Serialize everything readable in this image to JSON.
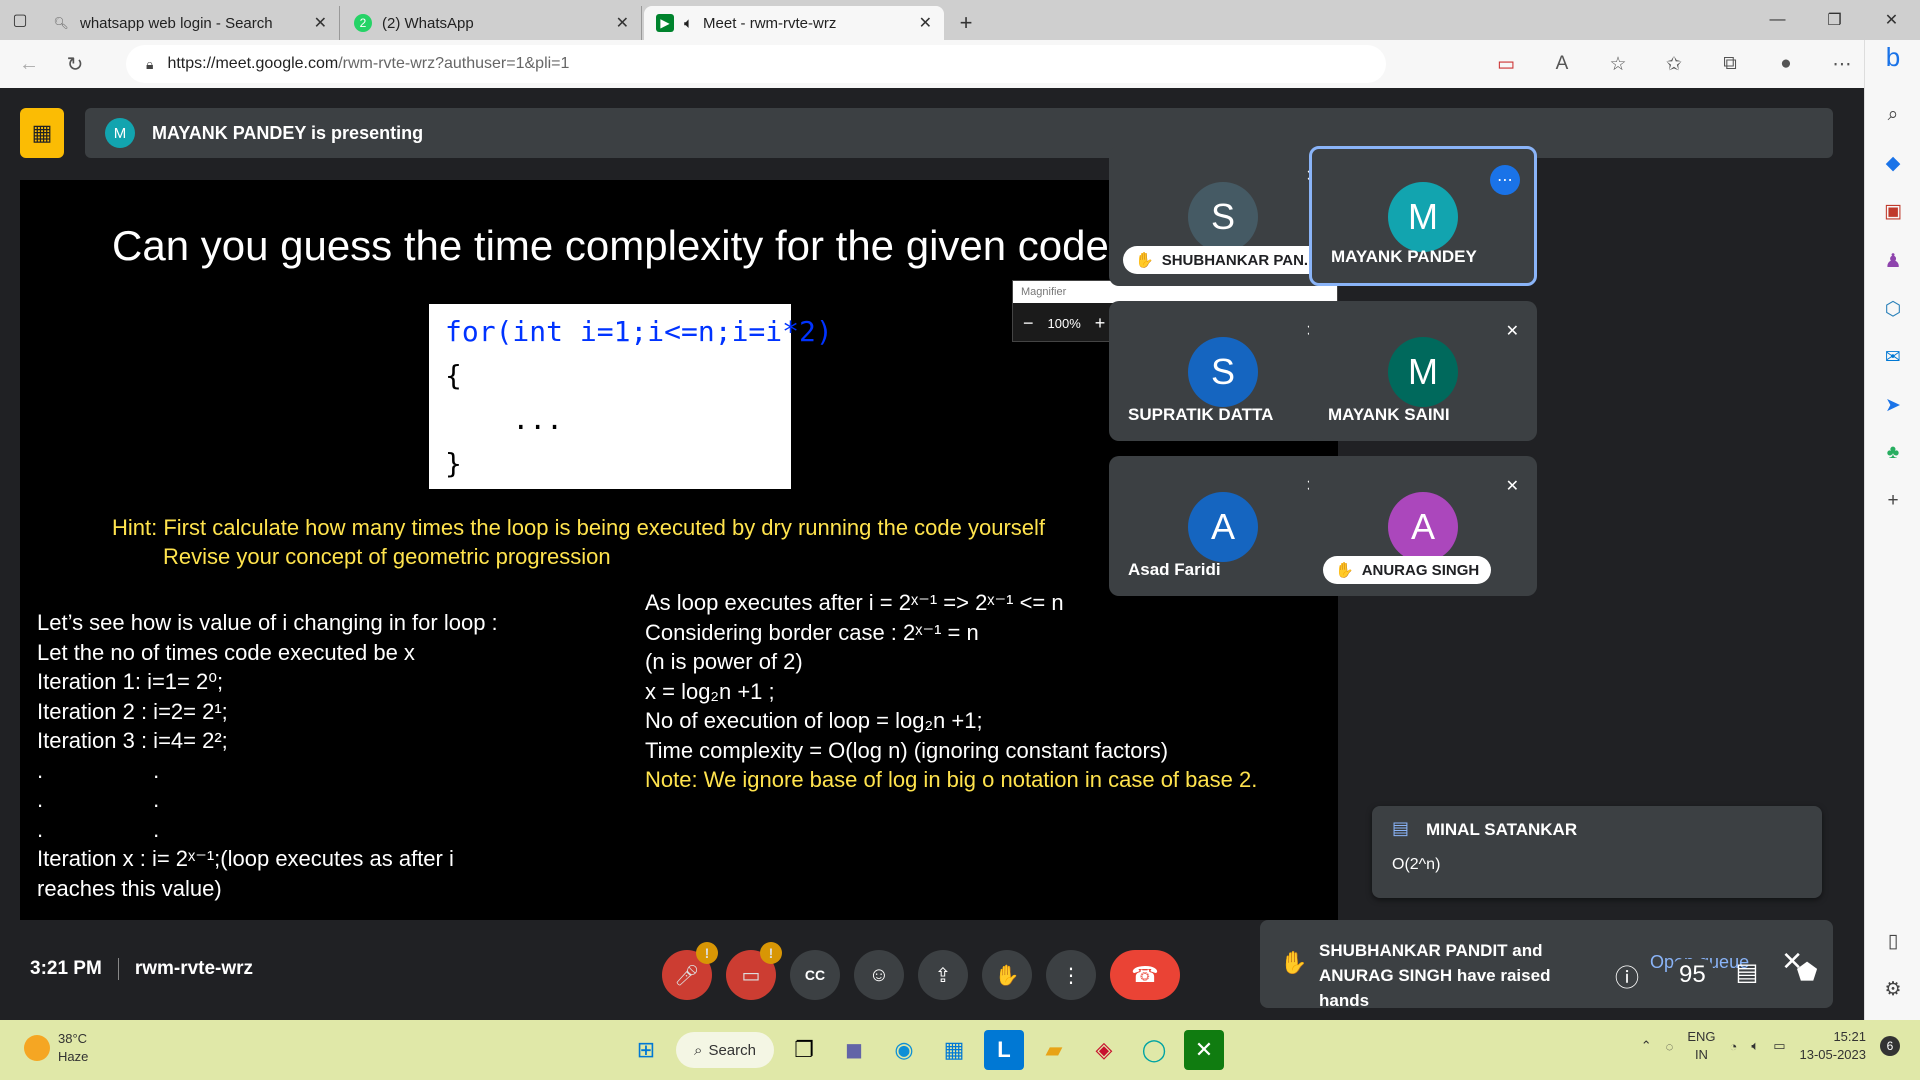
{
  "tabs": [
    {
      "label": "whatsapp web login - Search",
      "icon": "search-icon"
    },
    {
      "label": "(2) WhatsApp",
      "icon": "whatsapp-icon",
      "badge": "2"
    },
    {
      "label": "Meet - rwm-rvte-wrz",
      "icon": "meet-icon"
    }
  ],
  "url": {
    "host": "https://meet.google.com",
    "path": "/rwm-rvte-wrz?authuser=1&pli=1"
  },
  "presenter": {
    "initial": "M",
    "text": "MAYANK PANDEY is presenting"
  },
  "magnifier": {
    "title": "Magnifier",
    "zoom": "100%"
  },
  "slide": {
    "title": "Can you guess the time complexity for the given code",
    "code": [
      "for(int i=1;i<=n;i=i*2)",
      "{",
      "    ...",
      "}"
    ],
    "hint1": "Hint: First calculate how many times the loop is being executed by dry running the code yourself",
    "hint2": "Revise your concept of geometric progression",
    "left": [
      "Let’s see how is value of i changing in for loop :",
      "Let the no of times code executed be x",
      "Iteration 1: i=1= 2⁰;",
      "Iteration 2 : i=2= 2¹;",
      "Iteration 3 : i=4= 2²;",
      ".                  .",
      ".                  .",
      ".                  .",
      "Iteration x : i= 2ˣ⁻¹;(loop executes as after i",
      "reaches this value)"
    ],
    "right": [
      "As loop executes after i = 2ˣ⁻¹  =>  2ˣ⁻¹ <= n",
      "Considering border case : 2ˣ⁻¹ = n",
      "(n is power of 2)",
      "x = log₂n +1 ;",
      "No of execution of loop = log₂n +1;",
      "Time complexity = O(log n) (ignoring constant factors)"
    ],
    "note": "Note: We ignore base of log in big o notation in case of base 2."
  },
  "participants": [
    {
      "initial": "S",
      "name": "SHUBHANKAR PAN...",
      "color": "#455a64",
      "hand": true
    },
    {
      "initial": "M",
      "name": "MAYANK PANDEY",
      "color": "#12a4af",
      "selected": true
    },
    {
      "initial": "S",
      "name": "SUPRATIK DATTA",
      "color": "#1565c0"
    },
    {
      "initial": "M",
      "name": "MAYANK SAINI",
      "color": "#00695c"
    },
    {
      "initial": "A",
      "name": "Asad Faridi",
      "color": "#1565c0"
    },
    {
      "initial": "A",
      "name": "ANURAG SINGH",
      "color": "#ab47bc",
      "hand": true
    }
  ],
  "chat": {
    "name": "MINAL SATANKAR",
    "message": "O(2^n)"
  },
  "hands": {
    "text": "SHUBHANKAR PANDIT and ANURAG SINGH have raised hands",
    "action": "Open queue"
  },
  "meeting": {
    "time": "3:21 PM",
    "code": "rwm-rvte-wrz",
    "people_count": "95"
  },
  "taskbar": {
    "temp": "38°C",
    "weather": "Haze",
    "search": "Search",
    "lang1": "ENG",
    "lang2": "IN",
    "time": "15:21",
    "date": "13-05-2023",
    "notifications": "6"
  }
}
